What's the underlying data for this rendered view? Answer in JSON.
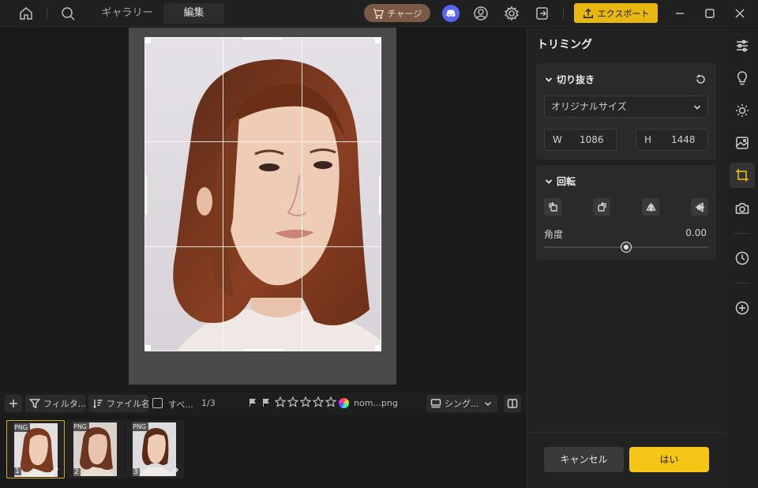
{
  "topbar": {
    "tabs": [
      "ギャラリー",
      "編集"
    ],
    "charge_label": "チャージ",
    "export_label": "エクスポート"
  },
  "toolbar": {
    "filter_label": "フィルタ...",
    "sort_label": "ファイル名",
    "select_all_label": "すべ...",
    "count": "1/3",
    "filename": "nom...png",
    "view_label": "シング...",
    "rating": 0
  },
  "filmstrip": {
    "items": [
      {
        "badge": "PNG",
        "num": "1",
        "selected": true,
        "edited": true
      },
      {
        "badge": "PNG",
        "num": "2",
        "selected": false,
        "edited": false
      },
      {
        "badge": "PNG",
        "num": "3",
        "selected": false,
        "edited": true
      }
    ]
  },
  "panel": {
    "title": "トリミング",
    "crop": {
      "heading": "切り抜き",
      "aspect": "オリジナルサイズ",
      "w_label": "W",
      "w_value": "1086",
      "h_label": "H",
      "h_value": "1448"
    },
    "rotate": {
      "heading": "回転",
      "angle_label": "角度",
      "angle_value": "0.00",
      "angle_fraction": 0.5
    },
    "cancel_label": "キャンセル",
    "ok_label": "はい"
  },
  "rail": {
    "icons": [
      "adjust-sliders-icon",
      "bulb-icon",
      "sun-icon",
      "image-edit-icon",
      "crop-icon",
      "camera-icon",
      "history-clock-icon",
      "add-circle-icon"
    ],
    "active": "crop-icon"
  },
  "colors": {
    "accent": "#f5c518",
    "export": "#e8b710",
    "charge": "#7a5a47",
    "discord": "#5865f2"
  }
}
